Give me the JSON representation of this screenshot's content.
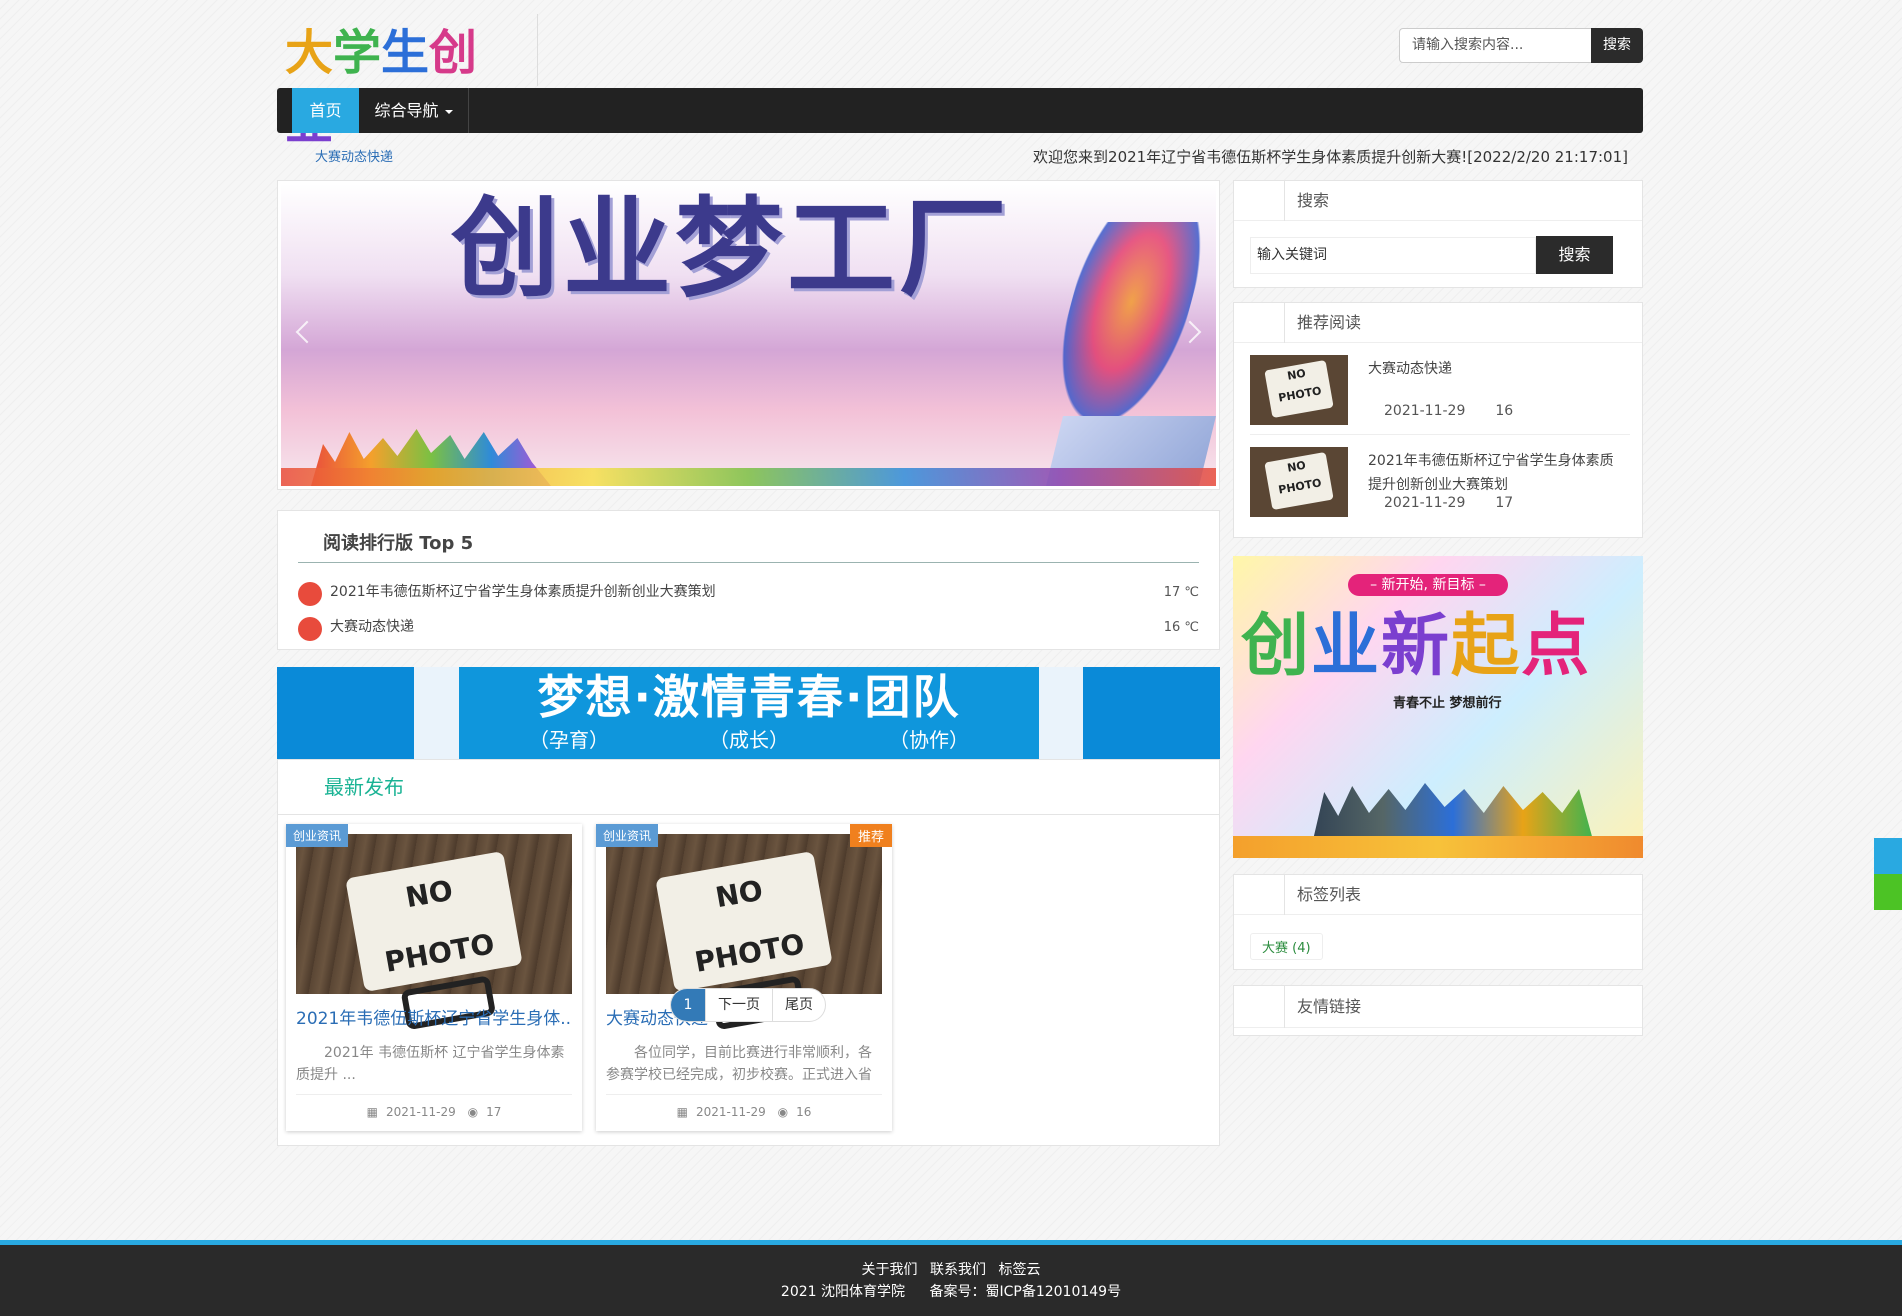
{
  "header": {
    "logo_chars": [
      "大",
      "学",
      "生",
      "创",
      "业"
    ],
    "search_placeholder": "请输入搜索内容...",
    "search_button": "搜索"
  },
  "nav": {
    "home": "首页",
    "guide": "综合导航"
  },
  "ticker": {
    "label": "大赛动态快递",
    "message": "欢迎您来到2021年辽宁省韦德伍斯杯学生身体素质提升创新大赛![2022/2/20 21:17:01]"
  },
  "banner": {
    "title": "创业梦工厂"
  },
  "ranking": {
    "title": "阅读排行版 Top 5",
    "items": [
      {
        "title": "2021年韦德伍斯杯辽宁省学生身体素质提升创新创业大赛策划",
        "value": "17 ℃"
      },
      {
        "title": "大赛动态快递",
        "value": "16 ℃"
      }
    ]
  },
  "ad_banner": {
    "main": "梦想·激情青春·团队",
    "subs": [
      "（孕育）",
      "（成长）",
      "（协作）"
    ]
  },
  "latest": {
    "title": "最新发布",
    "posts": [
      {
        "category": "创业资讯",
        "badge": "",
        "thumb_text": "NO PHOTO",
        "title": "2021年韦德伍斯杯辽宁省学生身体...",
        "desc": "2021年 韦德伍斯杯 辽宁省学生身体素质提升 ...",
        "date": "2021-11-29",
        "views": "17"
      },
      {
        "category": "创业资讯",
        "badge": "推荐",
        "thumb_text": "NO PHOTO",
        "title": "大赛动态快递",
        "desc": "各位同学，目前比赛进行非常顺利，各参赛学校已经完成，初步校赛。正式进入省赛",
        "date": "2021-11-29",
        "views": "16"
      }
    ]
  },
  "pagination": {
    "current": "1",
    "next": "下一页",
    "last": "尾页"
  },
  "sidebar": {
    "search": {
      "title": "搜索",
      "placeholder": "输入关键词",
      "button": "搜索"
    },
    "recommended": {
      "title": "推荐阅读",
      "items": [
        {
          "title": "大赛动态快递",
          "date": "2021-11-29",
          "views": "16",
          "thumb_text": "NO PHOTO"
        },
        {
          "title": "2021年韦德伍斯杯辽宁省学生身体素质提升创新创业大赛策划",
          "date": "2021-11-29",
          "views": "17",
          "thumb_text": "NO PHOTO"
        }
      ]
    },
    "ad": {
      "top": "– 新开始, 新目标 –",
      "big": [
        "创",
        "业",
        "新",
        "起",
        "点"
      ],
      "slogan": "青春不止 梦想前行"
    },
    "tags": {
      "title": "标签列表",
      "items": [
        "大赛 (4)"
      ]
    },
    "links": {
      "title": "友情链接"
    }
  },
  "footer": {
    "links": [
      "关于我们",
      "联系我们",
      "标签云"
    ],
    "copyright": "2021 沈阳体育学院",
    "icp": "备案号：蜀ICP备12010149号"
  },
  "colors": {
    "accent_blue": "#29a9e1",
    "nav_dark": "#222222",
    "link_blue": "#2a6db5",
    "rank_red": "#e84b3c",
    "latest_green": "#1ab394",
    "badge_orange": "#f0801e",
    "float_green": "#4cc325"
  },
  "icons": [
    "caret-down-icon",
    "calendar-icon",
    "eye-icon",
    "prev-arrow-icon",
    "next-arrow-icon"
  ]
}
